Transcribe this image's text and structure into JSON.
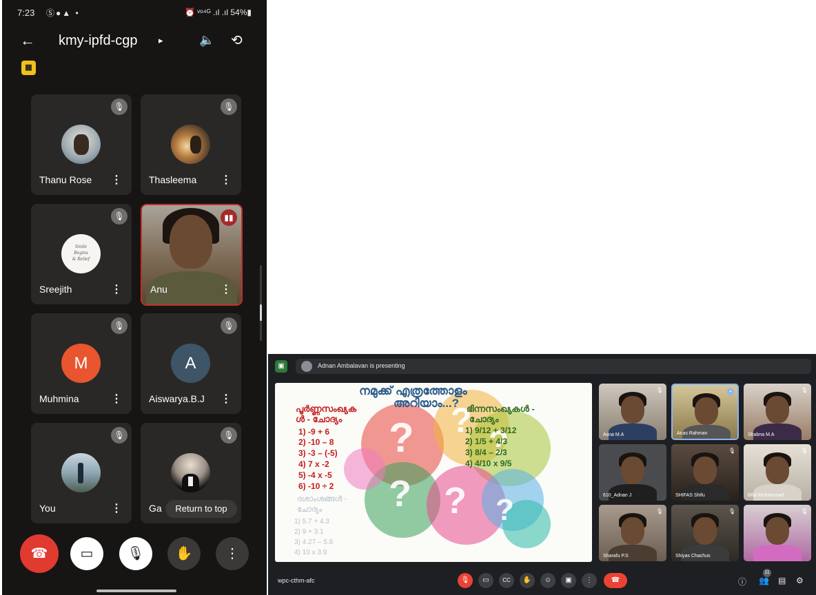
{
  "phone": {
    "status": {
      "time": "7:23",
      "left_icons": "Ⓢ●▲ •",
      "right": "⏰ ᵛᵒ⁴ᴳ .ıl .ıl 54%▮"
    },
    "header": {
      "back_icon": "arrow-back-icon",
      "title": "kmy-ipfd-cgp",
      "caret": "▸",
      "speaker_icon": "🔈",
      "flip_icon": "⟲"
    },
    "badge": "▦",
    "tiles": [
      {
        "name": "Thanu Rose",
        "more": "⋮",
        "mic": "🎙"
      },
      {
        "name": "Thasleema",
        "more": "⋮",
        "mic": "🎙"
      },
      {
        "name": "Sreejith",
        "more": "⋮",
        "mic": "🎙",
        "avatar_text": "Smile\nBegins\n& Relief"
      },
      {
        "name": "Anu",
        "more": "⋮",
        "mic": "▮▮"
      },
      {
        "name": "Muhmina",
        "more": "⋮",
        "mic": "🎙",
        "letter": "M",
        "color": "#e8552e"
      },
      {
        "name": "Aiswarya.B.J",
        "more": "⋮",
        "mic": "🎙",
        "letter": "A",
        "color": "#3d5566"
      },
      {
        "name": "You",
        "more": "⋮",
        "mic": "🎙"
      },
      {
        "name": "Ga",
        "more": "⋮",
        "mic": "🎙"
      }
    ],
    "return_to_top": "Return to top",
    "controls": {
      "end": "☎",
      "camera": "▭",
      "mic": "🎙",
      "hand": "✋",
      "more": "⋮"
    }
  },
  "meet": {
    "logo": "▣",
    "presenting": "Adnan Ambalavan is presenting",
    "slide": {
      "title1": "നമുക്ക് എത്രത്തോളം",
      "title2": "അറിയാം...?",
      "left_heading1": "പൂർണ്ണസംഖ്യക",
      "left_heading2": "ൾ - ചോദ്യം",
      "left_items": [
        "1)  -9 + 6",
        "2)  -10 – 8",
        "3)  -3 – (-5)",
        "4)  7 x -2",
        "5)  -4 x -5",
        "6)  -10 ÷ 2"
      ],
      "right_heading1": "ഭിന്നസംഖ്യകൾ -",
      "right_heading2": "ചോദ്യം",
      "right_items": [
        "1)  9/12 + 3/12",
        "2)  1/5 + 4/3",
        "3)  8/4 – 2/3",
        "4)  4/10 x 9/5"
      ],
      "faded_heading1": "ദശാംശങ്ങൾ -",
      "faded_heading2": "ചോദ്യം",
      "faded_items": [
        "1)  5.7 + 4.3",
        "2)  9 + 3.1",
        "3)  4.27 – 5.6",
        "4)  10 x 3.9"
      ]
    },
    "tiles": [
      {
        "name": "Asna M.A"
      },
      {
        "name": "Anas Rahman"
      },
      {
        "name": "Shabna M.A"
      },
      {
        "name": "610_Adnan J"
      },
      {
        "name": "SHIFAS Shifu"
      },
      {
        "name": "Bilal Muhammad"
      },
      {
        "name": "Sharafu P.S"
      },
      {
        "name": "Shiyas Chachus"
      },
      {
        "name": ""
      }
    ],
    "meeting_code": "wpc-cthm-afc",
    "participant_count": "11",
    "controls": [
      "🎙",
      "▭",
      "CC",
      "✋",
      "☺",
      "▣",
      "⋮",
      "☎"
    ],
    "right_controls": [
      "ⓘ",
      "👥",
      "▤",
      "⚙"
    ]
  }
}
